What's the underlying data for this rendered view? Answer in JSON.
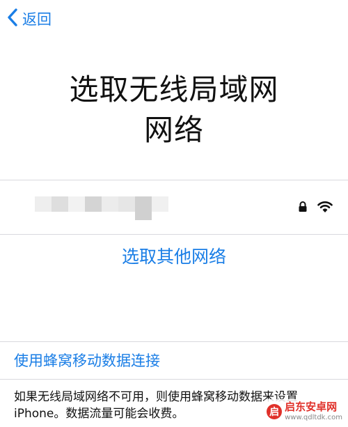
{
  "nav": {
    "back_label": "返回"
  },
  "title": {
    "line1": "选取无线局域网",
    "line2": "网络"
  },
  "network": {
    "name_blurred": true,
    "blur_cells": [
      "#eeeeee",
      "#dedede",
      "#f2f2f2",
      "#d4d4d4",
      "#ececec",
      "#e6e6e6",
      "#d0d0d0",
      "#f0f0f0"
    ],
    "icons": [
      "lock-icon",
      "wifi-icon"
    ]
  },
  "choose_other_label": "选取其他网络",
  "cellular_link_label": "使用蜂窝移动数据连接",
  "note": {
    "line1": "如果无线局域网络不可用，则使用蜂窝移动数据来设置",
    "line2": "iPhone。数据流量可能会收费。"
  },
  "watermark": {
    "name": "启东安卓网",
    "url": "www.qdltdk.com"
  },
  "colors": {
    "accent": "#1a7ee6",
    "text": "#111111",
    "divider": "#d9d9de",
    "watermark": "#e0312a"
  }
}
